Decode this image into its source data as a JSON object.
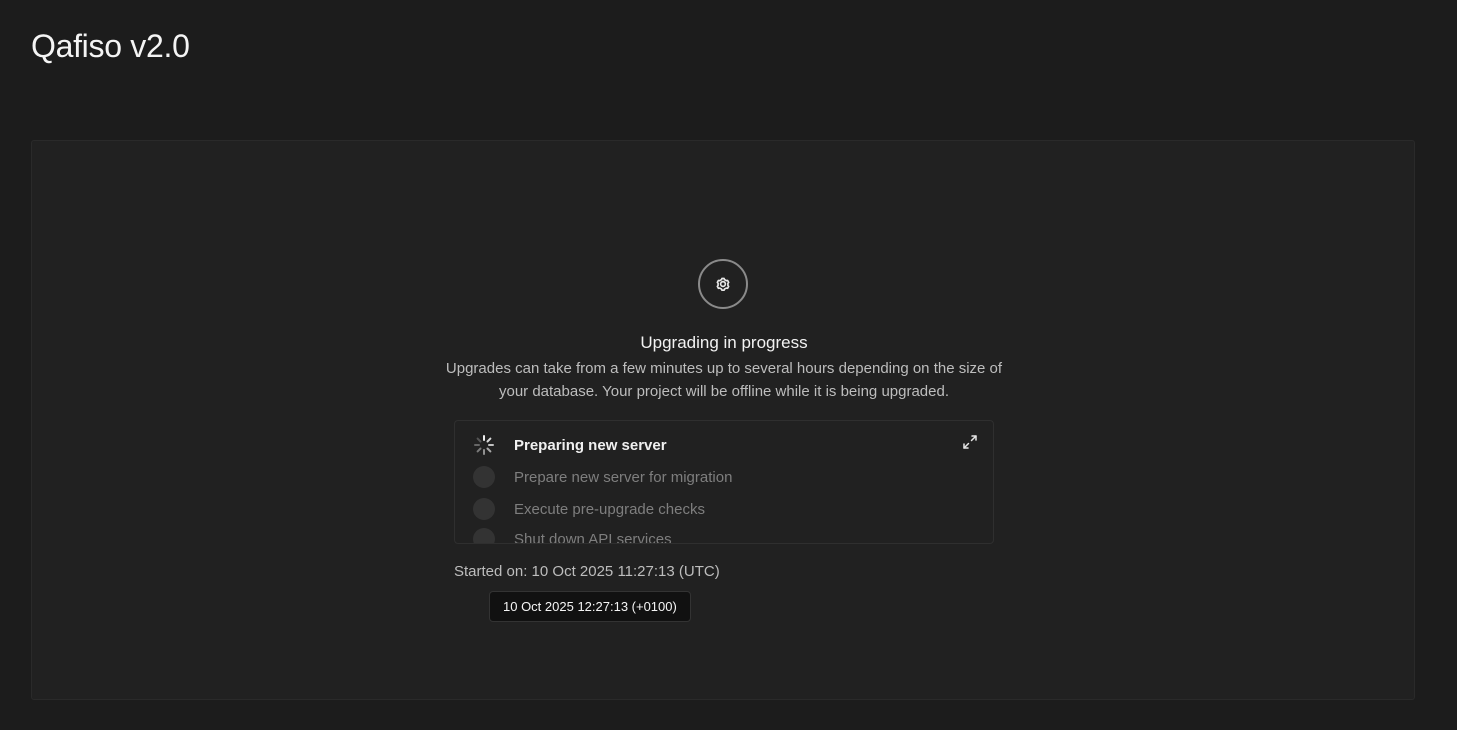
{
  "header": {
    "title": "Qafiso v2.0"
  },
  "upgrade": {
    "icon": "gear-icon",
    "heading": "Upgrading in progress",
    "description": "Upgrades can take from a few minutes up to several hours depending on the size of your database. Your project will be offline while it is being upgraded.",
    "steps": [
      {
        "label": "Preparing new server",
        "status": "in-progress"
      },
      {
        "label": "Prepare new server for migration",
        "status": "pending"
      },
      {
        "label": "Execute pre-upgrade checks",
        "status": "pending"
      },
      {
        "label": "Shut down API services",
        "status": "pending"
      }
    ],
    "expand_icon": "expand-icon",
    "started_on": "Started on: 10 Oct 2025 11:27:13 (UTC)",
    "tooltip": "10 Oct 2025 12:27:13 (+0100)"
  },
  "colors": {
    "background": "#1c1c1c",
    "panel": "#212121",
    "text_primary": "#f2f2f2",
    "text_muted": "#bdbdbd",
    "text_pending": "#7e7e7e"
  }
}
